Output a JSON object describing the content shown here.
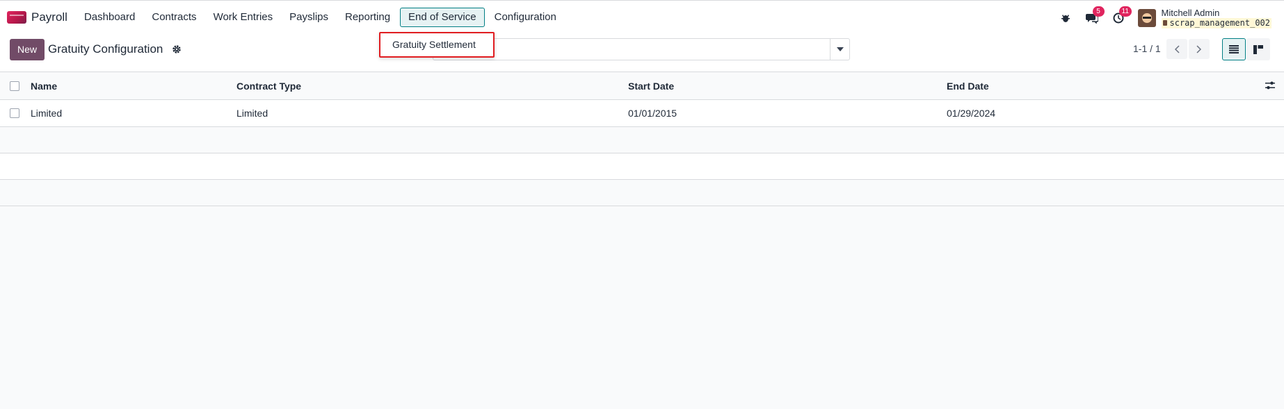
{
  "app": {
    "name": "Payroll"
  },
  "menu": [
    {
      "label": "Dashboard"
    },
    {
      "label": "Contracts"
    },
    {
      "label": "Work Entries"
    },
    {
      "label": "Payslips"
    },
    {
      "label": "Reporting"
    },
    {
      "label": "End of Service",
      "active": true
    },
    {
      "label": "Configuration"
    }
  ],
  "dropdown": {
    "items": [
      {
        "label": "Gratuity Settlement"
      }
    ]
  },
  "systray": {
    "messages_count": "5",
    "activities_count": "11",
    "user_name": "Mitchell Admin",
    "database": "scrap_management_002"
  },
  "control": {
    "new_label": "New",
    "title": "Gratuity Configuration",
    "pager": "1-1 / 1"
  },
  "table": {
    "columns": [
      "Name",
      "Contract Type",
      "Start Date",
      "End Date"
    ],
    "rows": [
      {
        "name": "Limited",
        "contract_type": "Limited",
        "start_date": "01/01/2015",
        "end_date": "01/29/2024"
      }
    ]
  },
  "colors": {
    "brand": "#714b67",
    "accent": "#017e84",
    "badge": "#e0245e",
    "highlight": "#e11d21"
  },
  "icons": [
    "payroll-app-icon",
    "bug-icon",
    "chat-icon",
    "clock-icon",
    "gear-icon",
    "caret-down-icon",
    "chevron-left-icon",
    "chevron-right-icon",
    "list-view-icon",
    "kanban-view-icon",
    "column-options-icon"
  ]
}
